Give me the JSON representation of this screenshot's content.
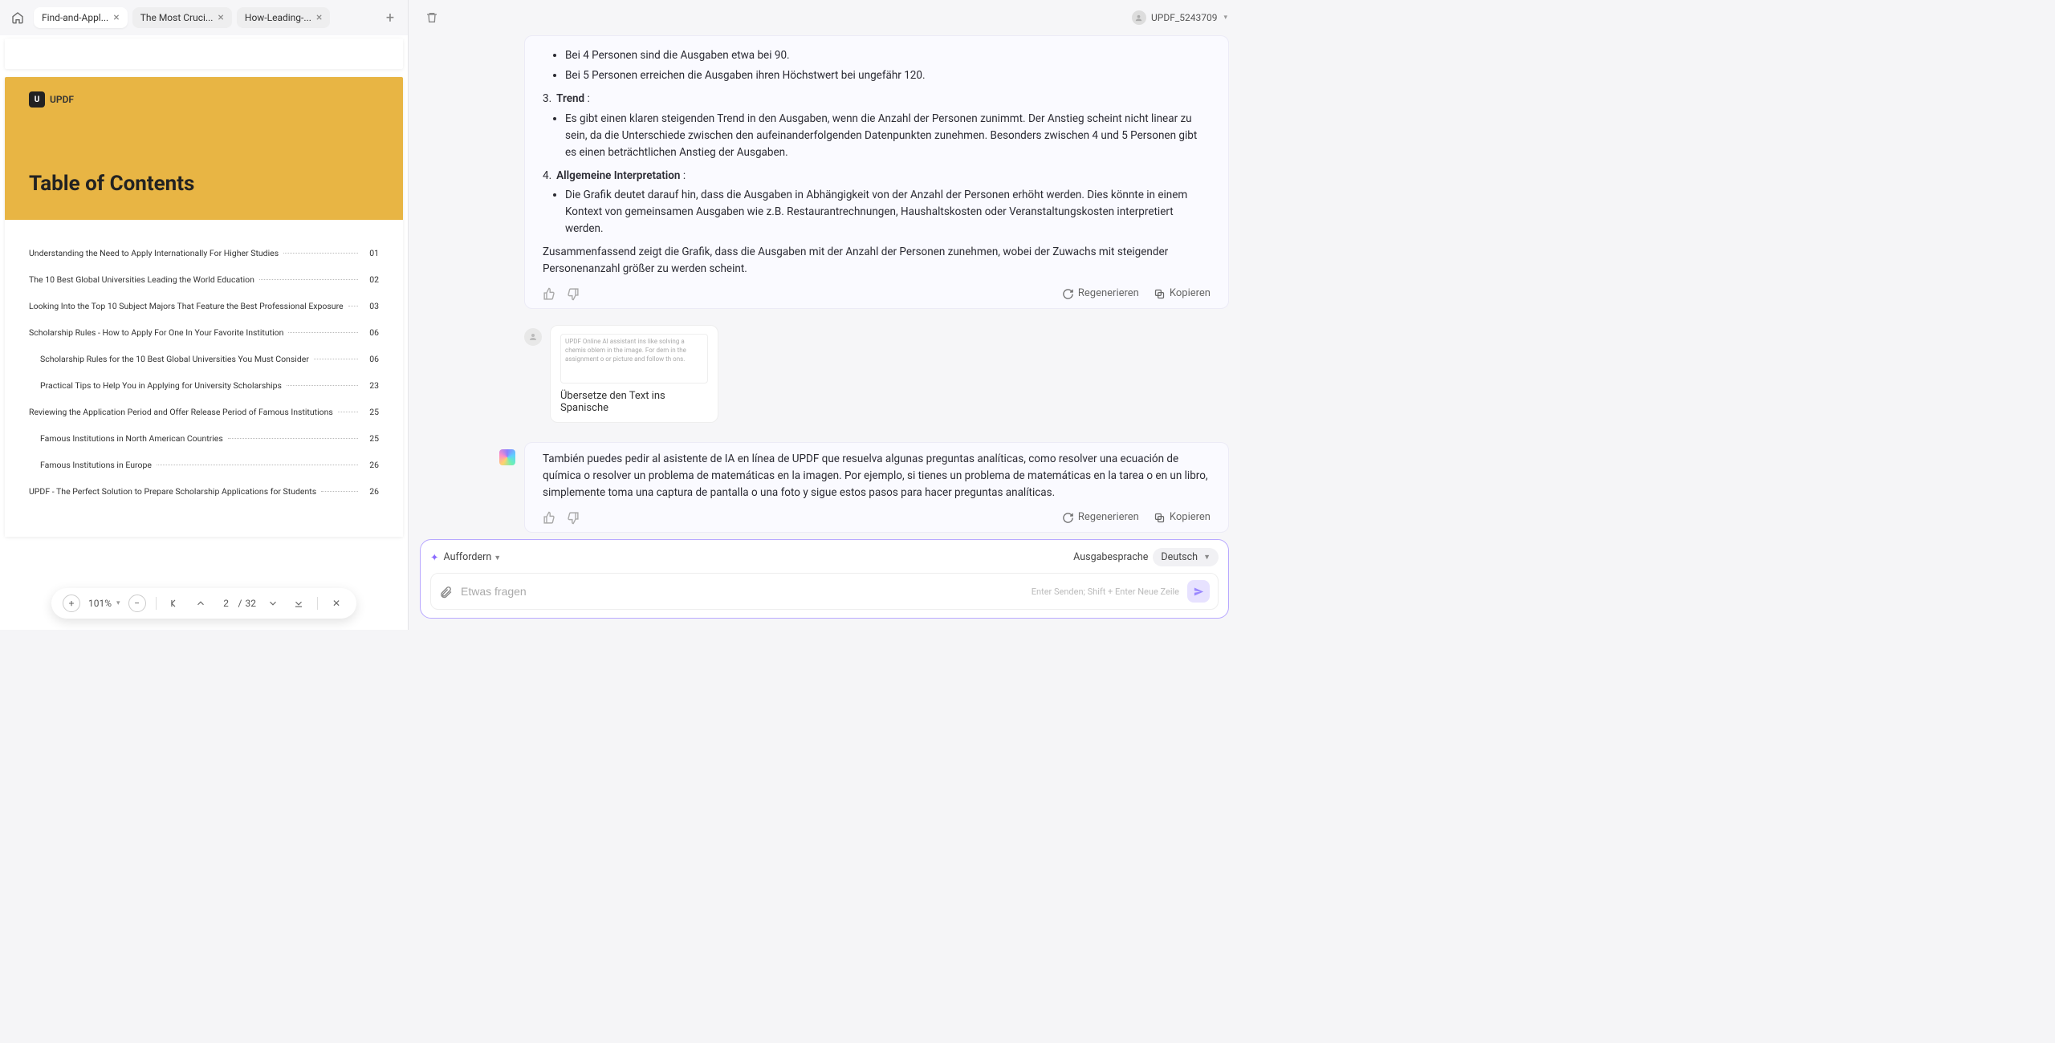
{
  "header": {
    "tabs": [
      {
        "label": "Find-and-Appl..."
      },
      {
        "label": "The Most Cruci..."
      },
      {
        "label": "How-Leading-..."
      }
    ],
    "user_label": "UPDF_5243709"
  },
  "doc": {
    "brand": "UPDF",
    "toc_title": "Table of Contents",
    "toc": [
      {
        "text": "Understanding the Need to Apply Internationally For Higher Studies",
        "page": "01",
        "sub": false
      },
      {
        "text": "The 10 Best Global Universities Leading the World Education",
        "page": "02",
        "sub": false
      },
      {
        "text": "Looking Into the Top 10 Subject Majors That Feature the Best Professional Exposure",
        "page": "03",
        "sub": false
      },
      {
        "text": "Scholarship Rules - How to Apply For One In Your Favorite Institution",
        "page": "06",
        "sub": false
      },
      {
        "text": "Scholarship Rules for the 10 Best Global Universities You Must Consider",
        "page": "06",
        "sub": true
      },
      {
        "text": "Practical Tips to Help You in Applying for University Scholarships",
        "page": "23",
        "sub": true
      },
      {
        "text": "Reviewing the Application Period and Offer Release Period of Famous Institutions",
        "page": "25",
        "sub": false
      },
      {
        "text": "Famous Institutions in North American Countries",
        "page": "25",
        "sub": true
      },
      {
        "text": "Famous Institutions in Europe",
        "page": "26",
        "sub": true
      },
      {
        "text": "UPDF - The Perfect Solution to Prepare Scholarship Applications for Students",
        "page": "26",
        "sub": false
      }
    ]
  },
  "toolbar": {
    "zoom": "101%",
    "page_current": "2",
    "page_sep": "/",
    "page_total": "32"
  },
  "chat": {
    "msg1": {
      "b1": "Bei 4 Personen sind die Ausgaben etwa bei 90.",
      "b2": "Bei 5 Personen erreichen die Ausgaben ihren Höchstwert bei ungefähr 120.",
      "ol3_num": "3.",
      "ol3_label": "Trend",
      "ol3_colon": " :",
      "ol3_b1": "Es gibt einen klaren steigenden Trend in den Ausgaben, wenn die Anzahl der Personen zunimmt. Der Anstieg scheint nicht linear zu sein, da die Unterschiede zwischen den aufeinanderfolgenden Datenpunkten zunehmen. Besonders zwischen 4 und 5 Personen gibt es einen beträchtlichen Anstieg der Ausgaben.",
      "ol4_num": "4.",
      "ol4_label": "Allgemeine Interpretation",
      "ol4_colon": " :",
      "ol4_b1": "Die Grafik deutet darauf hin, dass die Ausgaben in Abhängigkeit von der Anzahl der Personen erhöht werden. Dies könnte in einem Kontext von gemeinsamen Ausgaben wie z.B. Restaurantrechnungen, Haushaltskosten oder Veranstaltungskosten interpretiert werden.",
      "summary": "Zusammenfassend zeigt die Grafik, dass die Ausgaben mit der Anzahl der Personen zunehmen, wobei der Zuwachs mit steigender Personenanzahl größer zu werden scheint."
    },
    "user1": {
      "tiny": "UPDF Online AI assistant ins like solving a chemis oblem in the image. For dem in the assignment o or picture and follow th ons.",
      "caption": "Übersetze den Text ins Spanische"
    },
    "msg2": {
      "text": "También puedes pedir al asistente de IA en línea de UPDF que resuelva algunas preguntas analíticas, como resolver una ecuación de química o resolver un problema de matemáticas en la imagen. Por ejemplo, si tienes un problema de matemáticas en la tarea o en un libro, simplemente toma una captura de pantalla o una foto y sigue estos pasos para hacer preguntas analíticas."
    },
    "actions": {
      "regenerate": "Regenerieren",
      "copy": "Kopieren"
    }
  },
  "composer": {
    "mode_label": "Auffordern",
    "output_lang_label": "Ausgabesprache",
    "output_lang_value": "Deutsch",
    "placeholder": "Etwas fragen",
    "hint": "Enter Senden; Shift + Enter Neue Zeile"
  }
}
